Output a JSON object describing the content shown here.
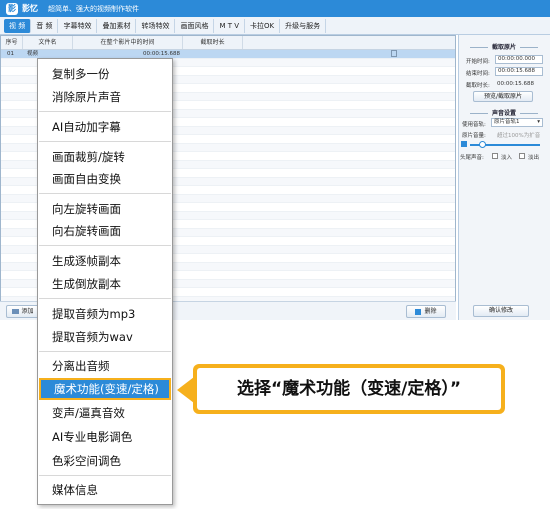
{
  "app": {
    "name": "影忆",
    "slogan": "超简单、强大的视频制作软件",
    "logo_icon": "app-logo-icon",
    "accent_color": "#2c8ad8"
  },
  "nav_tabs": [
    "视 频",
    "音 频",
    "字幕特效",
    "叠加素材",
    "转场特效",
    "画面风格",
    "M T V",
    "卡拉OK",
    "升级与服务"
  ],
  "table": {
    "headers": [
      "序号",
      "文件名",
      "在整个影片中的时间",
      "截取时长"
    ],
    "first_row": {
      "index": "01",
      "name": "视频",
      "time": "00:00:15.688"
    }
  },
  "bottom_bar": {
    "add_label": "添加",
    "delete_label": "删除"
  },
  "panel": {
    "trim_title": "截取原片",
    "start_label": "开始时间:",
    "start_value": "00:00:00.000",
    "end_label": "结束时间:",
    "end_value": "00:00:15.688",
    "duration_label": "截取时长:",
    "duration_value": "00:00:15.688",
    "preview_button": "预览/截取原片",
    "audio_title": "声音设置",
    "track_label": "使用音轨:",
    "track_value": "原片音轨1",
    "volume_label": "原片音量:",
    "volume_hint": "超过100%为扩音",
    "fade_label": "头尾声音:",
    "fade_in": "淡入",
    "fade_out": "淡出",
    "confirm_button": "确认修改"
  },
  "context_menu": {
    "items": [
      "复制多一份",
      "消除原片声音",
      "AI自动加字幕",
      "画面裁剪/旋转",
      "画面自由变换",
      "向左旋转画面",
      "向右旋转画面",
      "生成逐帧副本",
      "生成倒放副本",
      "提取音频为mp3",
      "提取音频为wav",
      "分离出音频",
      "魔术功能(变速/定格)",
      "变声/逼真音效",
      "AI专业电影调色",
      "色彩空间调色",
      "媒体信息"
    ],
    "highlighted": "魔术功能(变速/定格)"
  },
  "callout": {
    "text": "选择“魔术功能（变速/定格）”",
    "color": "#f6b01c"
  }
}
